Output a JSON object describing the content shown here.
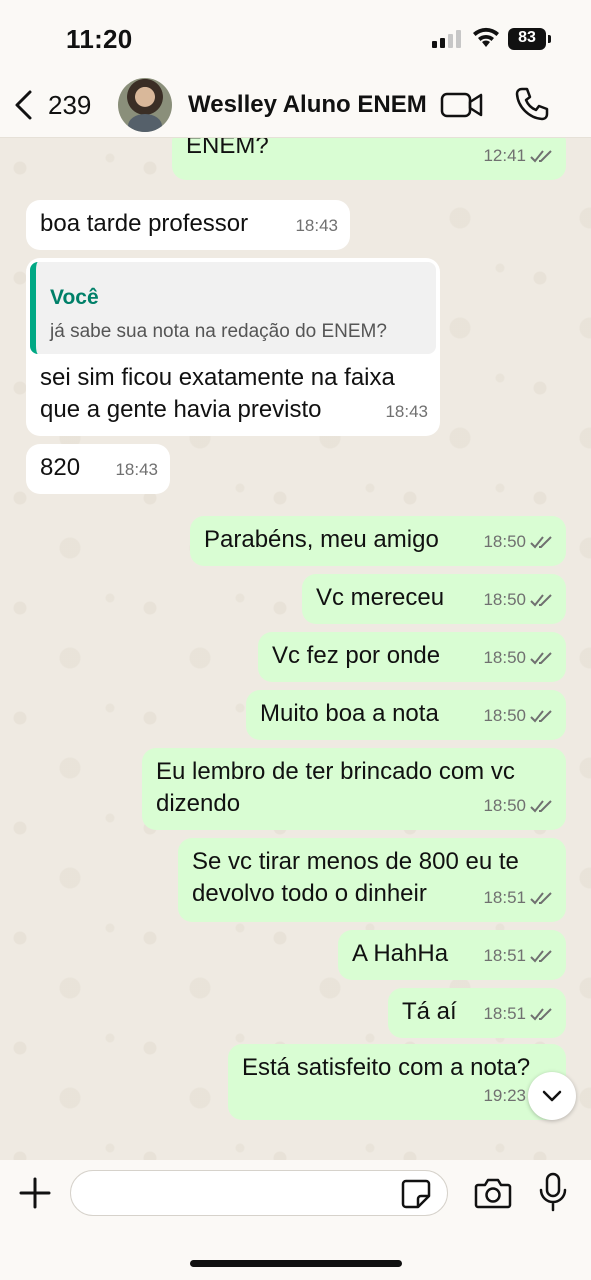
{
  "status_bar": {
    "time": "11:20",
    "battery": "83"
  },
  "header": {
    "back_count": "239",
    "contact_name": "Weslley Aluno ENEM"
  },
  "messages": [
    {
      "dir": "out",
      "text": "ENEM?",
      "time": "12:41"
    },
    {
      "dir": "in",
      "text": "boa tarde professor",
      "time": "18:43"
    },
    {
      "dir": "in",
      "quote_author": "Você",
      "quote_text": "já sabe sua nota na redação do ENEM?",
      "text_line1": "sei sim ficou exatamente na faixa",
      "text_line2": "que a gente havia previsto",
      "time": "18:43"
    },
    {
      "dir": "in",
      "text": "820",
      "time": "18:43"
    },
    {
      "dir": "out",
      "text": "Parabéns, meu amigo",
      "time": "18:50"
    },
    {
      "dir": "out",
      "text": "Vc mereceu",
      "time": "18:50"
    },
    {
      "dir": "out",
      "text": "Vc fez por onde",
      "time": "18:50"
    },
    {
      "dir": "out",
      "text": "Muito boa a nota",
      "time": "18:50"
    },
    {
      "dir": "out",
      "text_line1": "Eu lembro de ter brincado com vc",
      "text_line2": "dizendo",
      "time": "18:50"
    },
    {
      "dir": "out",
      "text_line1": "Se vc tirar menos de 800 eu te",
      "text_line2": "devolvo todo o dinheir",
      "time": "18:51"
    },
    {
      "dir": "out",
      "text": "A HahHa",
      "time": "18:51"
    },
    {
      "dir": "out",
      "text": "Tá aí",
      "time": "18:51"
    },
    {
      "dir": "out",
      "text": "Está satisfeito com a nota?",
      "time": "19:23"
    }
  ],
  "input": {
    "value": "",
    "placeholder": ""
  },
  "colors": {
    "outgoing_bubble": "#d9fdd3",
    "incoming_bubble": "#ffffff",
    "accent": "#00a884",
    "read_check": "#707070"
  }
}
